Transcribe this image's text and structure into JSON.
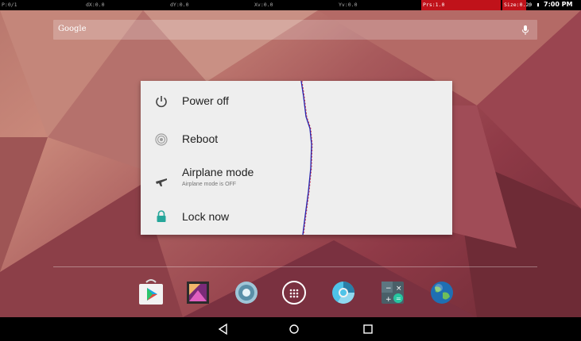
{
  "pointer_location": {
    "p": "P:0/1",
    "dx": "dX:0.0",
    "dy": "dY:0.0",
    "xv": "Xv:0.0",
    "yv": "Yv:0.0",
    "prs": "Prs:1.0",
    "size": "Size:0.20"
  },
  "status_bar": {
    "time": "7:00 PM"
  },
  "search": {
    "logo_text": "Google"
  },
  "power_menu": {
    "items": [
      {
        "label": "Power off",
        "icon": "power-icon"
      },
      {
        "label": "Reboot",
        "icon": "reboot-icon"
      },
      {
        "label": "Airplane mode",
        "sublabel": "Airplane mode is OFF",
        "icon": "airplane-icon"
      },
      {
        "label": "Lock now",
        "icon": "lock-icon"
      }
    ]
  },
  "dock": {
    "apps": [
      {
        "name": "Play Store",
        "icon": "play-store-icon"
      },
      {
        "name": "Gallery",
        "icon": "gallery-icon"
      },
      {
        "name": "Settings",
        "icon": "settings-icon"
      },
      {
        "name": "All apps",
        "icon": "app-drawer-icon"
      },
      {
        "name": "Chrome-like browser",
        "icon": "browser-icon"
      },
      {
        "name": "Calculator",
        "icon": "calculator-icon"
      },
      {
        "name": "Browser",
        "icon": "globe-icon"
      }
    ]
  },
  "navigation": {
    "buttons": [
      "back",
      "home",
      "recents"
    ]
  },
  "colors": {
    "dialog_bg": "#eeeeee",
    "lock_icon": "#26a69a",
    "status_red": "#c0121a"
  }
}
